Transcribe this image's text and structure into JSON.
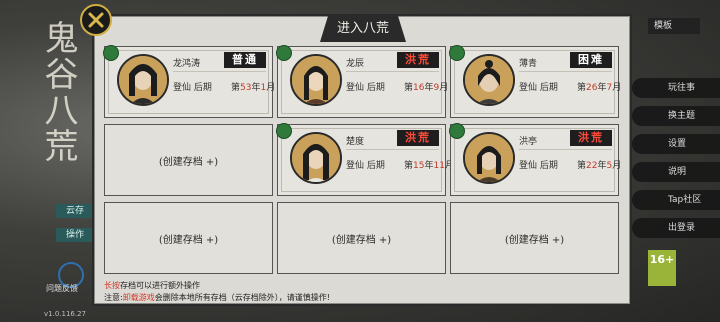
{
  "panel": {
    "title": "进入八荒"
  },
  "slots": [
    {
      "name": "龙鸿涛",
      "realm": "登仙 后期",
      "date_prefix": "第",
      "year": "53",
      "year_unit": "年",
      "month": "1",
      "month_unit": "月",
      "difficulty": "普通",
      "difficulty_color": "#ffffff"
    },
    {
      "name": "龙辰",
      "realm": "登仙 后期",
      "date_prefix": "第",
      "year": "16",
      "year_unit": "年",
      "month": "9",
      "month_unit": "月",
      "difficulty": "洪荒",
      "difficulty_color": "#ff4a3a"
    },
    {
      "name": "薄青",
      "realm": "登仙 后期",
      "date_prefix": "第",
      "year": "26",
      "year_unit": "年",
      "month": "7",
      "month_unit": "月",
      "difficulty": "困难",
      "difficulty_color": "#ffffff"
    },
    {
      "empty_label": "(创建存档 +)"
    },
    {
      "name": "楚度",
      "realm": "登仙 后期",
      "date_prefix": "第",
      "year": "15",
      "year_unit": "年",
      "month": "11",
      "month_unit": "月",
      "difficulty": "洪荒",
      "difficulty_color": "#ff4a3a"
    },
    {
      "name": "洪亭",
      "realm": "登仙 后期",
      "date_prefix": "第",
      "year": "22",
      "year_unit": "年",
      "month": "5",
      "month_unit": "月",
      "difficulty": "洪荒",
      "difficulty_color": "#ff4a3a"
    },
    {
      "empty_label": "(创建存档 +)"
    },
    {
      "empty_label": "(创建存档 +)"
    },
    {
      "empty_label": "(创建存档 +)"
    }
  ],
  "notes": {
    "line1_highlight": "长按",
    "line1_text": "存档可以进行额外操作",
    "line2_prefix": "注意:",
    "line2_highlight": "卸载游戏",
    "line2_text": "会删除本地所有存档（云存档除外），请谨慎操作!"
  },
  "background": {
    "side_btn_1": "云存",
    "side_btn_2": "操作",
    "help_label": "问题反馈",
    "version": "v1.0.116.27",
    "dropdown_label": "模板",
    "right_menu": [
      "玩往事",
      "换主题",
      "设置",
      "说明",
      "Tap社区",
      "出登录"
    ],
    "age_rating": "16+"
  }
}
